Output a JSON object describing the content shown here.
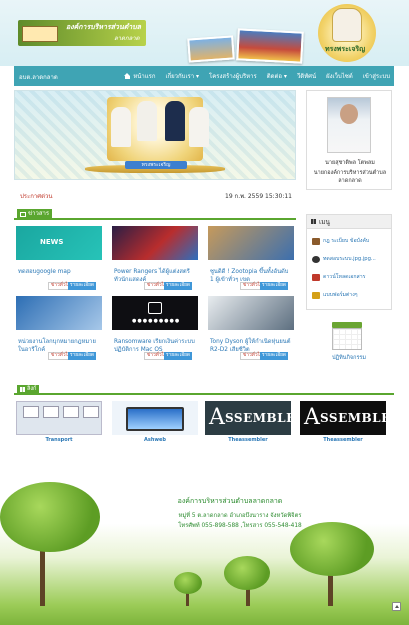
{
  "header": {
    "logo_title": "องค์การบริหารส่วนตำบล",
    "logo_subtitle": "ลาดกลาด",
    "royal_label": "ทรงพระเจริญ"
  },
  "nav": {
    "brand": "อบต.ลาดกลาด",
    "items": [
      {
        "label": "หน้าแรก"
      },
      {
        "label": "เกี่ยวกับเรา ▾"
      },
      {
        "label": "โครงสร้างผู้บริหาร"
      },
      {
        "label": "ติดต่อ ▾"
      },
      {
        "label": "วีดิทัศน์"
      },
      {
        "label": "ผังเว็บไซต์"
      },
      {
        "label": "เข้าสู่ระบบ"
      }
    ]
  },
  "slider": {
    "ribbon_text": "ทรงพระเจริญ"
  },
  "profile": {
    "name": "นายสุชาติพล โตพลม",
    "role": "นายกองค์การบริหารส่วนตำบลลาดกลาด"
  },
  "announce": {
    "label": "ประกาศด่วน",
    "datetime": "19 ก.พ. 2559 15:30:11"
  },
  "news": {
    "heading": "ข่าวสาร",
    "btn_news": "ข่าวทั่วไป",
    "btn_detail": "รายละเอียด",
    "items": [
      {
        "title": "ทดสอบgoogle map",
        "badge": "NEWS"
      },
      {
        "title": "Power Rangers ได้ผู้แต่งสตรีทัวนักแสดงค์",
        "badge": ""
      },
      {
        "title": "ซูนดิดี ! Zootopia ขึ้นทั้งอันดับ 1 ผู้เข้าทั่วๆ เขต",
        "badge": ""
      },
      {
        "title": "หน่วยงานโลกบุกหมายกฎหมายในอารีโกค์",
        "badge": ""
      },
      {
        "title": "Ransomware เรียกเงินค่าระบบปฏิบัติการ Mac OS",
        "badge": "●●●●●●●●●"
      },
      {
        "title": "Tony Dyson ผู้ให้กำเนิดหุ่นยนต์ R2-D2 เสียชีวิต",
        "badge": ""
      }
    ]
  },
  "menu": {
    "heading": "เมนู",
    "items": [
      {
        "label": "กฎ ระเบียบ ข้อบังคับ"
      },
      {
        "label": "ทดสอบระบบ.jpg.jpg..."
      },
      {
        "label": "ดาวน์โหลดเอกสาร"
      },
      {
        "label": "แบบฟอร์มต่างๆ"
      }
    ],
    "calendar_label": "ปฏิทินกิจกรรม"
  },
  "links": {
    "heading": "ลิงก์",
    "items": [
      {
        "label": "Transport"
      },
      {
        "label": "Ashweb"
      },
      {
        "label": "Theassembler",
        "logo": "SSEMBLER"
      },
      {
        "label": "Theassembler",
        "logo": "SSEMBLER"
      }
    ]
  },
  "footer": {
    "title": "องค์การบริหารส่วนตำบลลาดกลาด",
    "address": "หมู่ที่ 5 ต.ลาดกลาด อำเภอบึงนาราง จังหวัดพิจิตร",
    "phone": "โทรศัพท์ 055-898-588 ,โทรสาร 055-548-418"
  }
}
